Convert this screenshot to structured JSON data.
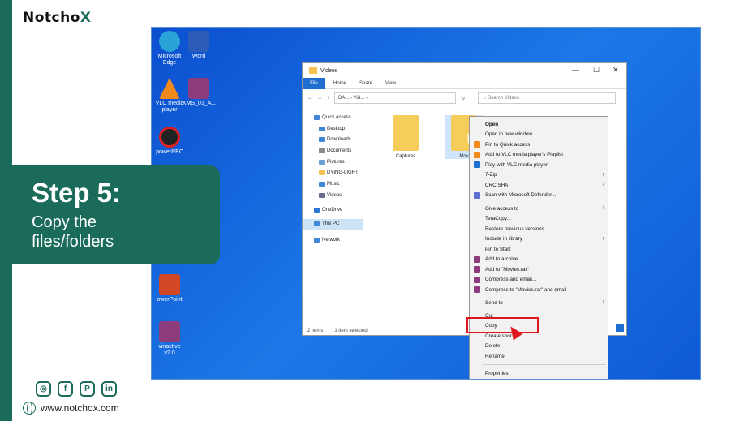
{
  "brand": {
    "logo_main": "Notcho",
    "logo_accent": "X",
    "website": "www.notchox.com",
    "accent_color": "#1b6b5a"
  },
  "step": {
    "title": "Step 5:",
    "description": "Copy the files/folders"
  },
  "social_icons": [
    "instagram-icon",
    "facebook-icon",
    "pinterest-icon",
    "linkedin-icon"
  ],
  "desktop_icons": [
    {
      "label": "Microsoft Edge",
      "icon": "edge-icon",
      "color": "#29a3d8"
    },
    {
      "label": "Word",
      "icon": "word-icon",
      "color": "#2b5cb8"
    },
    {
      "label": "VLC media player",
      "icon": "vlc-icon",
      "color": "#f08a1c"
    },
    {
      "label": "KMS_01_A...",
      "icon": "winrar-icon",
      "color": "#8c3b7c"
    },
    {
      "label": "powerREC",
      "icon": "record-icon",
      "color": "#e02020"
    },
    {
      "label": "owerPoint",
      "icon": "powerpoint-icon",
      "color": "#d24726"
    },
    {
      "label": "vinactive v2.0",
      "icon": "winrar-icon",
      "color": "#8c3b7c"
    }
  ],
  "explorer": {
    "title": "Videos",
    "ribbon_tabs": [
      "File",
      "Home",
      "Share",
      "View"
    ],
    "address": "DA...  ›  Vid...  ›",
    "search_placeholder": "Search Videos",
    "nav_items": [
      {
        "label": "Quick access",
        "color": "#3f86d6"
      },
      {
        "label": "Desktop",
        "color": "#3f86d6"
      },
      {
        "label": "Downloads",
        "color": "#3f86d6"
      },
      {
        "label": "Documents",
        "color": "#8a8a8a"
      },
      {
        "label": "Pictures",
        "color": "#6aa0d8"
      },
      {
        "label": "DYING-LIGHT",
        "color": "#f4c14c"
      },
      {
        "label": "Music",
        "color": "#3f86d6"
      },
      {
        "label": "Videos",
        "color": "#6a6a8a"
      },
      {
        "label": "OneDrive",
        "color": "#2b78d4"
      },
      {
        "label": "This PC",
        "color": "#3f86d6"
      },
      {
        "label": "Network",
        "color": "#3f86d6"
      }
    ],
    "folders": [
      "Captures",
      "Mov"
    ],
    "status_items": "2 items",
    "status_selected": "1 item selected"
  },
  "context_menu": {
    "items": [
      "Open",
      "Open in new window",
      "Pin to Quick access",
      "Add to VLC media player's Playlist",
      "Play with VLC media player",
      "7-Zip",
      "CRC SHA",
      "Scan with Microsoft Defender...",
      "Give access to",
      "TeraCopy...",
      "Restore previous versions",
      "Include in library",
      "Pin to Start",
      "Add to archive...",
      "Add to \"Movies.rar\"",
      "Compress and email...",
      "Compress to \"Movies.rar\" and email",
      "Send to",
      "Cut",
      "Copy",
      "Create shor",
      "Delete",
      "Rename",
      "Properties"
    ],
    "highlight_color": "#e0161e"
  }
}
